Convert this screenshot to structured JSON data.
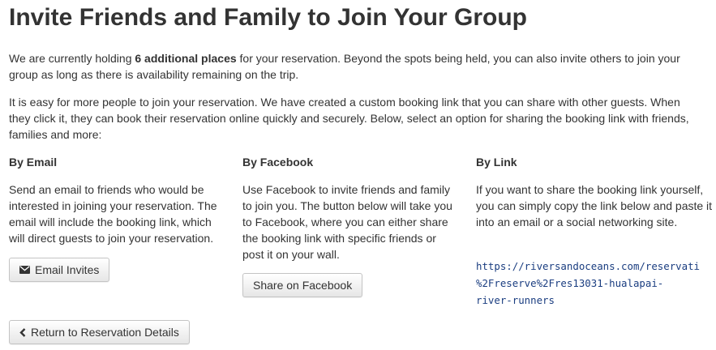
{
  "page": {
    "title": "Invite Friends and Family to Join Your Group",
    "intro1_before": "We are currently holding ",
    "intro1_bold": "6 additional places",
    "intro1_after": " for your reservation. Beyond the spots being held, you can also invite others to join your group as long as there is availability remaining on the trip.",
    "intro2": "It is easy for more people to join your reservation. We have created a custom booking link that you can share with other guests. When they click it, they can book their reservation online quickly and securely. Below, select an option for sharing the booking link with friends, families and more:"
  },
  "email": {
    "heading": "By Email",
    "text": "Send an email to friends who would be interested in joining your reservation. The email will include the booking link, which will direct guests to join your reservation.",
    "button_label": "Email Invites",
    "button_icon": "envelope-icon"
  },
  "facebook": {
    "heading": "By Facebook",
    "text": "Use Facebook to invite friends and family to join you. The button below will take you to Facebook, where you can either share the booking link with specific friends or post it on your wall.",
    "button_label": "Share on Facebook"
  },
  "link": {
    "heading": "By Link",
    "text": "If you want to share the booking link yourself, you can simply copy the link below and paste it into an email or a social networking site.",
    "url_line1": "https://riversandoceans.com/reservati",
    "url_line2": "%2Freserve%2Fres13031-hualapai-",
    "url_line3": "river-runners"
  },
  "footer": {
    "back_label": "Return to Reservation Details",
    "back_icon": "chevron-left-icon"
  },
  "colors": {
    "text": "#333333",
    "link": "#1a3d80",
    "button_border": "#c4c4c4"
  }
}
